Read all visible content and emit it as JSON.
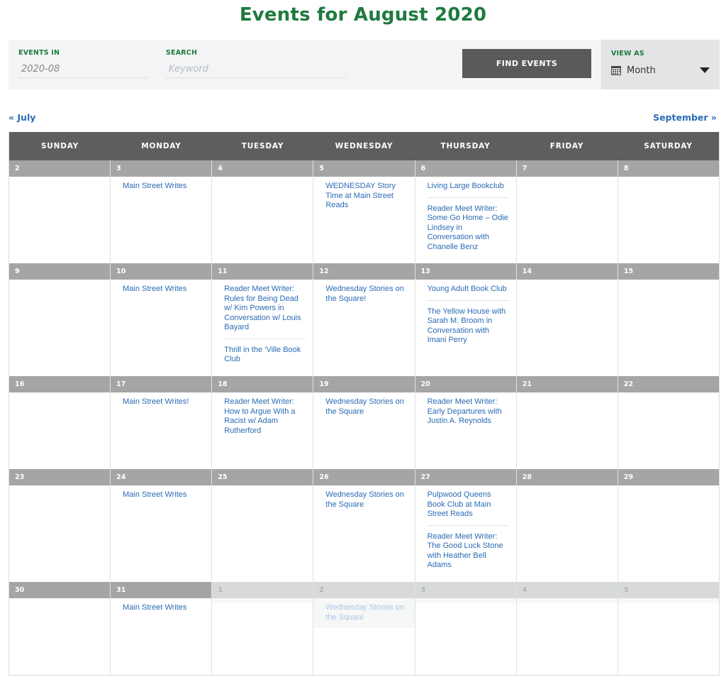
{
  "title": "Events for August 2020",
  "filter_bar": {
    "events_in_label": "EVENTS IN",
    "events_in_value": "2020-08",
    "search_label": "SEARCH",
    "search_placeholder": "Keyword",
    "find_button": "FIND EVENTS",
    "view_as_label": "VIEW AS",
    "view_as_value": "Month",
    "view_as_icon": "calendar-icon"
  },
  "nav": {
    "prev": "« July",
    "next": "September »"
  },
  "days_of_week": [
    "SUNDAY",
    "MONDAY",
    "TUESDAY",
    "WEDNESDAY",
    "THURSDAY",
    "FRIDAY",
    "SATURDAY"
  ],
  "weeks": [
    [
      {
        "day": "2",
        "events": []
      },
      {
        "day": "3",
        "events": [
          "Main Street Writes"
        ]
      },
      {
        "day": "4",
        "events": []
      },
      {
        "day": "5",
        "events": [
          "WEDNESDAY Story Time at Main Street Reads"
        ]
      },
      {
        "day": "6",
        "events": [
          "Living Large Bookclub",
          "Reader Meet Writer: Some Go Home – Odie Lindsey in Conversation with Chanelle Benz"
        ]
      },
      {
        "day": "7",
        "events": []
      },
      {
        "day": "8",
        "events": []
      }
    ],
    [
      {
        "day": "9",
        "events": []
      },
      {
        "day": "10",
        "events": [
          "Main Street Writes"
        ]
      },
      {
        "day": "11",
        "events": [
          "Reader Meet Writer: Rules for Being Dead w/ Kim Powers in Conversation w/ Louis Bayard",
          "Thrill in the ‘Ville Book Club"
        ]
      },
      {
        "day": "12",
        "events": [
          "Wednesday Stories on the Square!"
        ]
      },
      {
        "day": "13",
        "events": [
          "Young Adult Book Club",
          "The Yellow House with Sarah M. Broom in Conversation with Imani Perry"
        ]
      },
      {
        "day": "14",
        "events": []
      },
      {
        "day": "15",
        "events": []
      }
    ],
    [
      {
        "day": "16",
        "events": []
      },
      {
        "day": "17",
        "events": [
          "Main Street Writes!"
        ]
      },
      {
        "day": "18",
        "events": [
          "Reader Meet Writer: How to Argue With a Racist w/ Adam Rutherford"
        ]
      },
      {
        "day": "19",
        "events": [
          "Wednesday Stories on the Square"
        ]
      },
      {
        "day": "20",
        "events": [
          "Reader Meet Writer: Early Departures with Justin A. Reynolds"
        ]
      },
      {
        "day": "21",
        "events": []
      },
      {
        "day": "22",
        "events": []
      }
    ],
    [
      {
        "day": "23",
        "events": []
      },
      {
        "day": "24",
        "events": [
          "Main Street Writes"
        ]
      },
      {
        "day": "25",
        "events": []
      },
      {
        "day": "26",
        "events": [
          "Wednesday Stories on the Square"
        ]
      },
      {
        "day": "27",
        "events": [
          "Pulpwood Queens Book Club at Main Street Reads",
          "Reader Meet Writer: The Good Luck Stone with Heather Bell Adams"
        ]
      },
      {
        "day": "28",
        "events": []
      },
      {
        "day": "29",
        "events": []
      }
    ],
    [
      {
        "day": "30",
        "events": []
      },
      {
        "day": "31",
        "events": [
          "Main Street Writes"
        ]
      },
      {
        "day": "1",
        "other_month": true,
        "events": []
      },
      {
        "day": "2",
        "other_month": true,
        "events": [
          "Wednesday Stories on the Square"
        ]
      },
      {
        "day": "3",
        "other_month": true,
        "events": []
      },
      {
        "day": "4",
        "other_month": true,
        "events": []
      },
      {
        "day": "5",
        "other_month": true,
        "events": []
      }
    ]
  ],
  "colors": {
    "title": "#1f7a3e",
    "link": "#2a6bb5",
    "header_bg": "#5e5e5e",
    "day_number_bg": "#a5a5a5"
  }
}
